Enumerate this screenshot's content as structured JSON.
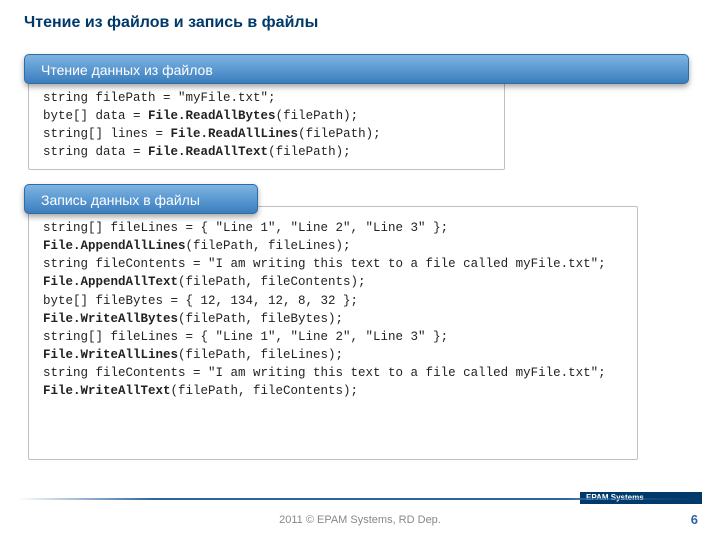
{
  "title": "Чтение из файлов и запись в файлы",
  "header1": "Чтение данных из файлов",
  "header2": "Запись данных в файлы",
  "code1": [
    {
      "t": "string filePath = \"myFile.txt\";"
    },
    {
      "t": "byte[] data = ",
      "b": "File.ReadAllBytes",
      "t2": "(filePath);"
    },
    {
      "t": "string[] lines = ",
      "b": "File.ReadAllLines",
      "t2": "(filePath);"
    },
    {
      "t": "string data = ",
      "b": "File.ReadAllText",
      "t2": "(filePath);"
    }
  ],
  "code2": [
    {
      "t": "string[] fileLines = { \"Line 1\", \"Line 2\", \"Line 3\" };"
    },
    {
      "b": "File.AppendAllLines",
      "t2": "(filePath, fileLines);"
    },
    {
      "t": "string fileContents = \"I am writing this text to a file called myFile.txt\";"
    },
    {
      "b": "File.AppendAllText",
      "t2": "(filePath, fileContents);"
    },
    {
      "t": "byte[] fileBytes = { 12, 134, 12, 8, 32 };"
    },
    {
      "b": "File.WriteAllBytes",
      "t2": "(filePath, fileBytes);"
    },
    {
      "t": "string[] fileLines = { \"Line 1\", \"Line 2\", \"Line 3\" };"
    },
    {
      "b": "File.WriteAllLines",
      "t2": "(filePath, fileLines);"
    },
    {
      "t": "string fileContents = \"I am writing this text to a file called myFile.txt\";"
    },
    {
      "b": "File.WriteAllText",
      "t2": "(filePath, fileContents);"
    }
  ],
  "footer": {
    "brand": "EPAM Systems",
    "copyright": "2011 © EPAM Systems, RD Dep.",
    "page": "6"
  }
}
